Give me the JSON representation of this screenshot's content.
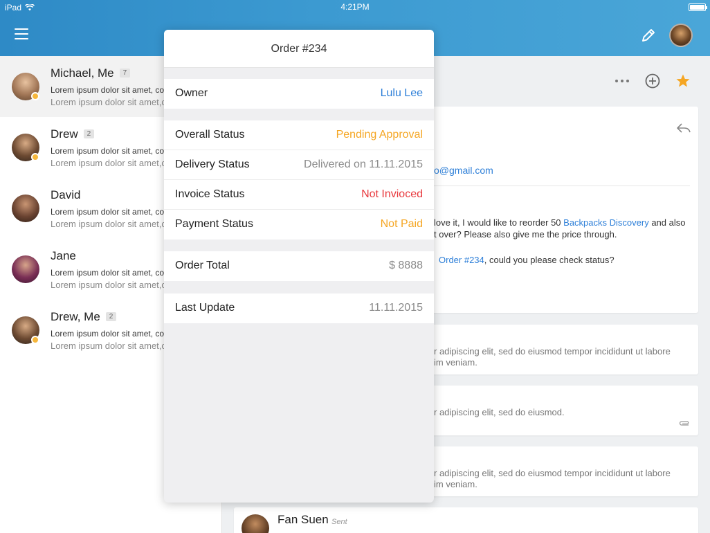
{
  "status_bar": {
    "device": "iPad",
    "time": "4:21PM"
  },
  "colors": {
    "accent": "#2e8ac6",
    "link": "#2d7fd8",
    "orange": "#f5a623",
    "red": "#e8383d",
    "grey": "#8a8a8a",
    "star": "#f5a623"
  },
  "conversations": [
    {
      "name": "Michael, Me",
      "count": "7",
      "line1": "Lorem ipsum dolor sit amet, co",
      "line2": "Lorem ipsum dolor sit amet,c"
    },
    {
      "name": "Drew",
      "count": "2",
      "line1": "Lorem ipsum dolor sit amet, co",
      "line2": "Lorem ipsum dolor sit amet,c"
    },
    {
      "name": "David",
      "count": "",
      "line1": "Lorem ipsum dolor sit amet, co",
      "line2": "Lorem ipsum dolor sit amet,c"
    },
    {
      "name": "Jane",
      "count": "",
      "line1": "Lorem ipsum dolor sit amet, co",
      "line2": "Lorem ipsum dolor sit amet,c"
    },
    {
      "name": "Drew, Me",
      "count": "2",
      "line1": "Lorem ipsum dolor sit amet, co",
      "line2": "Lorem ipsum dolor sit amet,c"
    }
  ],
  "email": {
    "address_fragment": "o@gmail.com",
    "body_line1_a": "love it, I would like to reorder 50 ",
    "body_line1_link": "Backpacks Discovery",
    "body_line1_b": " and also",
    "body_line2": "t over? Please also give me the price through.",
    "body_line3_link": "Order #234",
    "body_line3_b": ", could you please check status?"
  },
  "thread_cards": [
    {
      "line1": "r adipiscing elit, sed do eiusmod tempor incididunt ut labore",
      "line2": "im veniam."
    },
    {
      "line1": "r adipiscing elit, sed do eiusmod.",
      "line2": ""
    },
    {
      "line1": "r adipiscing elit, sed do eiusmod tempor incididunt ut labore",
      "line2": "im veniam."
    }
  ],
  "last_message": {
    "name": "Fan Suen",
    "tag": "Sent"
  },
  "popover": {
    "title": "Order #234",
    "owner": {
      "label": "Owner",
      "value": "Lulu Lee"
    },
    "status_rows": [
      {
        "label": "Overall Status",
        "value": "Pending Approval",
        "color": "#f5a623"
      },
      {
        "label": "Delivery Status",
        "value": "Delivered on 11.11.2015",
        "color": "#8a8a8a"
      },
      {
        "label": "Invoice Status",
        "value": "Not Invioced",
        "color": "#e8383d"
      },
      {
        "label": "Payment Status",
        "value": "Not Paid",
        "color": "#f5a623"
      }
    ],
    "total": {
      "label": "Order Total",
      "value": "$ 8888"
    },
    "last_update": {
      "label": "Last Update",
      "value": "11.11.2015"
    }
  }
}
